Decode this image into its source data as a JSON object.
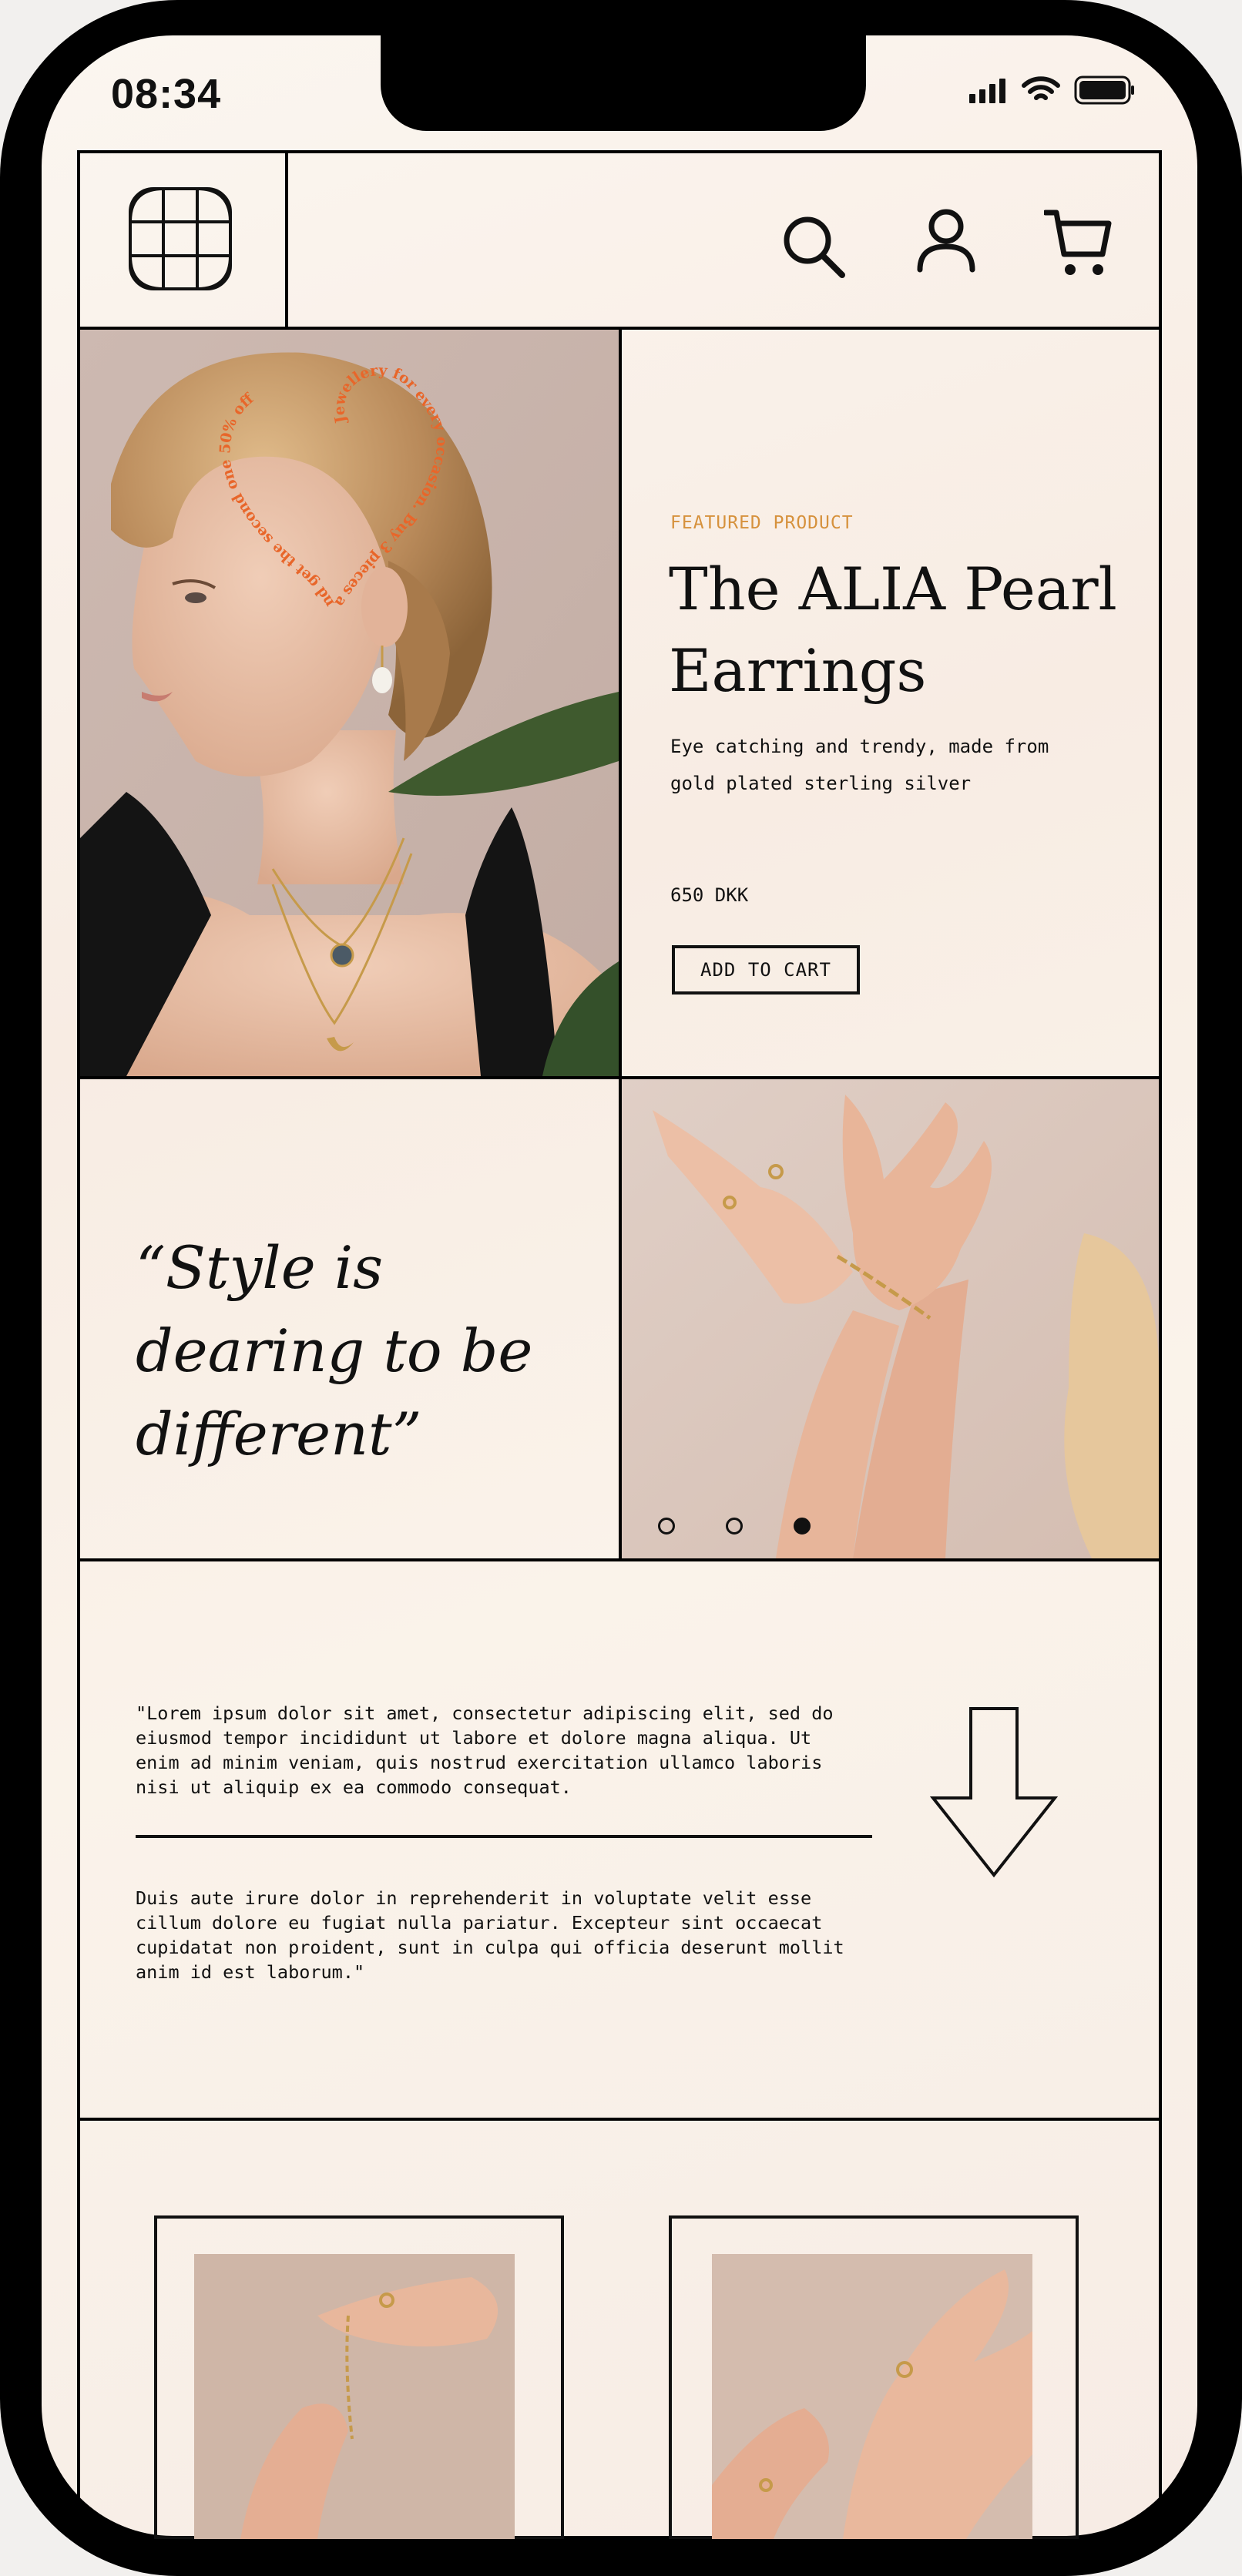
{
  "status_bar": {
    "time": "08:34"
  },
  "header": {
    "logo_icon": "grid-logo-icon",
    "search_icon": "search-icon",
    "account_icon": "user-icon",
    "cart_icon": "cart-icon"
  },
  "hero": {
    "eyebrow": "FEATURED PRODUCT",
    "title": "The ALIA Pearl Earrings",
    "description": "Eye catching and trendy, made from gold plated sterling silver",
    "price": "650 DKK",
    "cta_label": "ADD TO CART",
    "heart_text": "Jewellery for every occasion. Buy 3 pieces and get the second one 50% off"
  },
  "quote": {
    "text": "“Style is dearing to be different”"
  },
  "carousel": {
    "count": 3,
    "active_index": 3
  },
  "about": {
    "paragraph_1": "\"Lorem ipsum dolor sit amet, consectetur adipiscing elit, sed do eiusmod tempor incididunt ut labore et dolore magna aliqua. Ut enim ad minim veniam, quis nostrud exercitation ullamco laboris nisi ut aliquip ex ea commodo consequat.",
    "paragraph_2": "Duis aute irure dolor in reprehenderit in voluptate velit esse cillum dolore eu fugiat nulla pariatur. Excepteur sint occaecat cupidatat non proident, sunt in culpa qui officia deserunt mollit anim id est laborum.\"",
    "arrow_icon": "arrow-down-icon"
  },
  "colors": {
    "accent": "#d6913c",
    "heart_text": "#e8662a",
    "ink": "#111111"
  }
}
